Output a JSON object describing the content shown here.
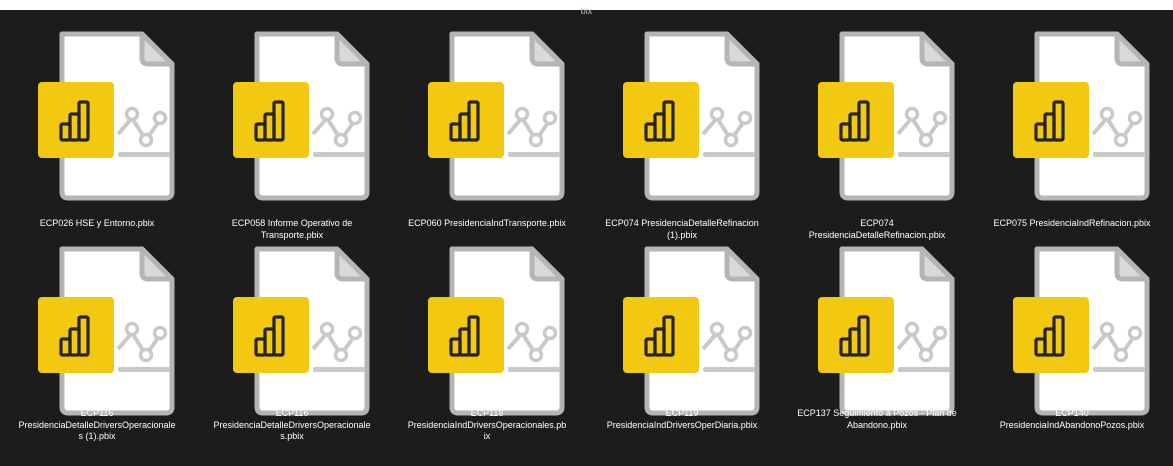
{
  "window": {
    "cut_off_label": "bix"
  },
  "colors": {
    "background": "#1c1c1c",
    "page": "#ffffff",
    "page_fold": "#d9d9d9",
    "outline": "#b5b5b5",
    "chart_line": "#c9c9c9",
    "badge": "#f2c811",
    "badge_icon": "#252423"
  },
  "icon": "power-bi-file-icon",
  "files": [
    {
      "name": "ECP026 HSE y Entorno.pbix"
    },
    {
      "name": "ECP058 Informe Operativo de\nTransporte.pbix"
    },
    {
      "name": "ECP060 PresidenciaIndTransporte.pbix"
    },
    {
      "name": "ECP074 PresidenciaDetalleRefinacion\n(1).pbix"
    },
    {
      "name": "ECP074\nPresidenciaDetalleRefinacion.pbix"
    },
    {
      "name": "ECP075 PresidenciaIndRefinacion.pbix"
    },
    {
      "name": "ECP116\nPresidenciaDetalleDriversOperacionale\ns (1).pbix"
    },
    {
      "name": "ECP116\nPresidenciaDetalleDriversOperacionale\ns.pbix"
    },
    {
      "name": "ECP118\nPresidenciaIndDriversOperacionales.pb\nix"
    },
    {
      "name": "ECP119\nPresidenciaIndDriversOperDiaria.pbix"
    },
    {
      "name": "ECP137 Seguimiento a Pozos - Plan de\nAbandono.pbix"
    },
    {
      "name": "ECP140\nPresidenciaIndAbandonoPozos.pbix"
    }
  ]
}
